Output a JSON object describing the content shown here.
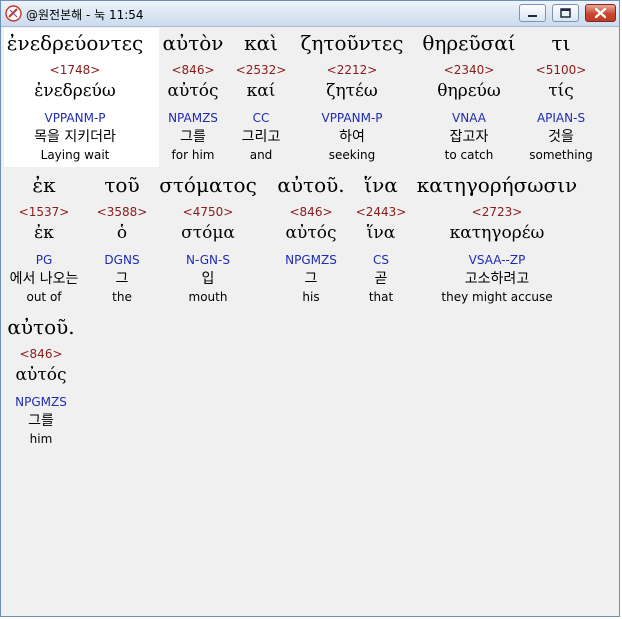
{
  "window": {
    "title": "@원전본해 - 눅 11:54",
    "buttons": [
      "minimize",
      "maximize",
      "close"
    ]
  },
  "colors": {
    "strong": "#8b1a1a",
    "parse": "#1f2bb3",
    "highlight": "#ffffff"
  },
  "rows": [
    {
      "words": [
        {
          "greek": "ἐνεδρεύοντες",
          "strong": "<1748>",
          "lemma": "ἐνεδρεύω",
          "parse": "VPPANM-P",
          "kor": "목을 지키더라",
          "eng": "Laying wait"
        },
        {
          "greek": "αὐτὸν",
          "strong": "<846>",
          "lemma": "αὐτός",
          "parse": "NPAMZS",
          "kor": "그를",
          "eng": "for him"
        },
        {
          "greek": "καὶ",
          "strong": "<2532>",
          "lemma": "καί",
          "parse": "CC",
          "kor": "그리고",
          "eng": "and"
        },
        {
          "greek": "ζητοῦντες",
          "strong": "<2212>",
          "lemma": "ζητέω",
          "parse": "VPPANM-P",
          "kor": "하여",
          "eng": "seeking"
        },
        {
          "greek": "θηρεῦσαί",
          "strong": "<2340>",
          "lemma": "θηρεύω",
          "parse": "VNAA",
          "kor": "잡고자",
          "eng": "to catch"
        },
        {
          "greek": "τι",
          "strong": "<5100>",
          "lemma": "τίς",
          "parse": "APIAN-S",
          "kor": "것을",
          "eng": "something"
        }
      ]
    },
    {
      "words": [
        {
          "greek": "ἐκ",
          "strong": "<1537>",
          "lemma": "ἐκ",
          "parse": "PG",
          "kor": "에서 나오는",
          "eng": "out of"
        },
        {
          "greek": "τοῦ",
          "strong": "<3588>",
          "lemma": "ὁ",
          "parse": "DGNS",
          "kor": "그",
          "eng": "the"
        },
        {
          "greek": "στόματος",
          "strong": "<4750>",
          "lemma": "στόμα",
          "parse": "N-GN-S",
          "kor": "입",
          "eng": "mouth"
        },
        {
          "greek": "αὐτοῦ.",
          "strong": "<846>",
          "lemma": "αὐτός",
          "parse": "NPGMZS",
          "kor": "그",
          "eng": "his"
        },
        {
          "greek": "ἵνα",
          "strong": "<2443>",
          "lemma": "ἵνα",
          "parse": "CS",
          "kor": "곧",
          "eng": "that"
        },
        {
          "greek": "κατηγορήσωσιν",
          "strong": "<2723>",
          "lemma": "κατηγορέω",
          "parse": "VSAA--ZP",
          "kor": "고소하려고",
          "eng": "they might accuse"
        }
      ]
    },
    {
      "words": [
        {
          "greek": "αὐτοῦ.",
          "strong": "<846>",
          "lemma": "αὐτός",
          "parse": "NPGMZS",
          "kor": "그를",
          "eng": "him"
        }
      ]
    }
  ]
}
